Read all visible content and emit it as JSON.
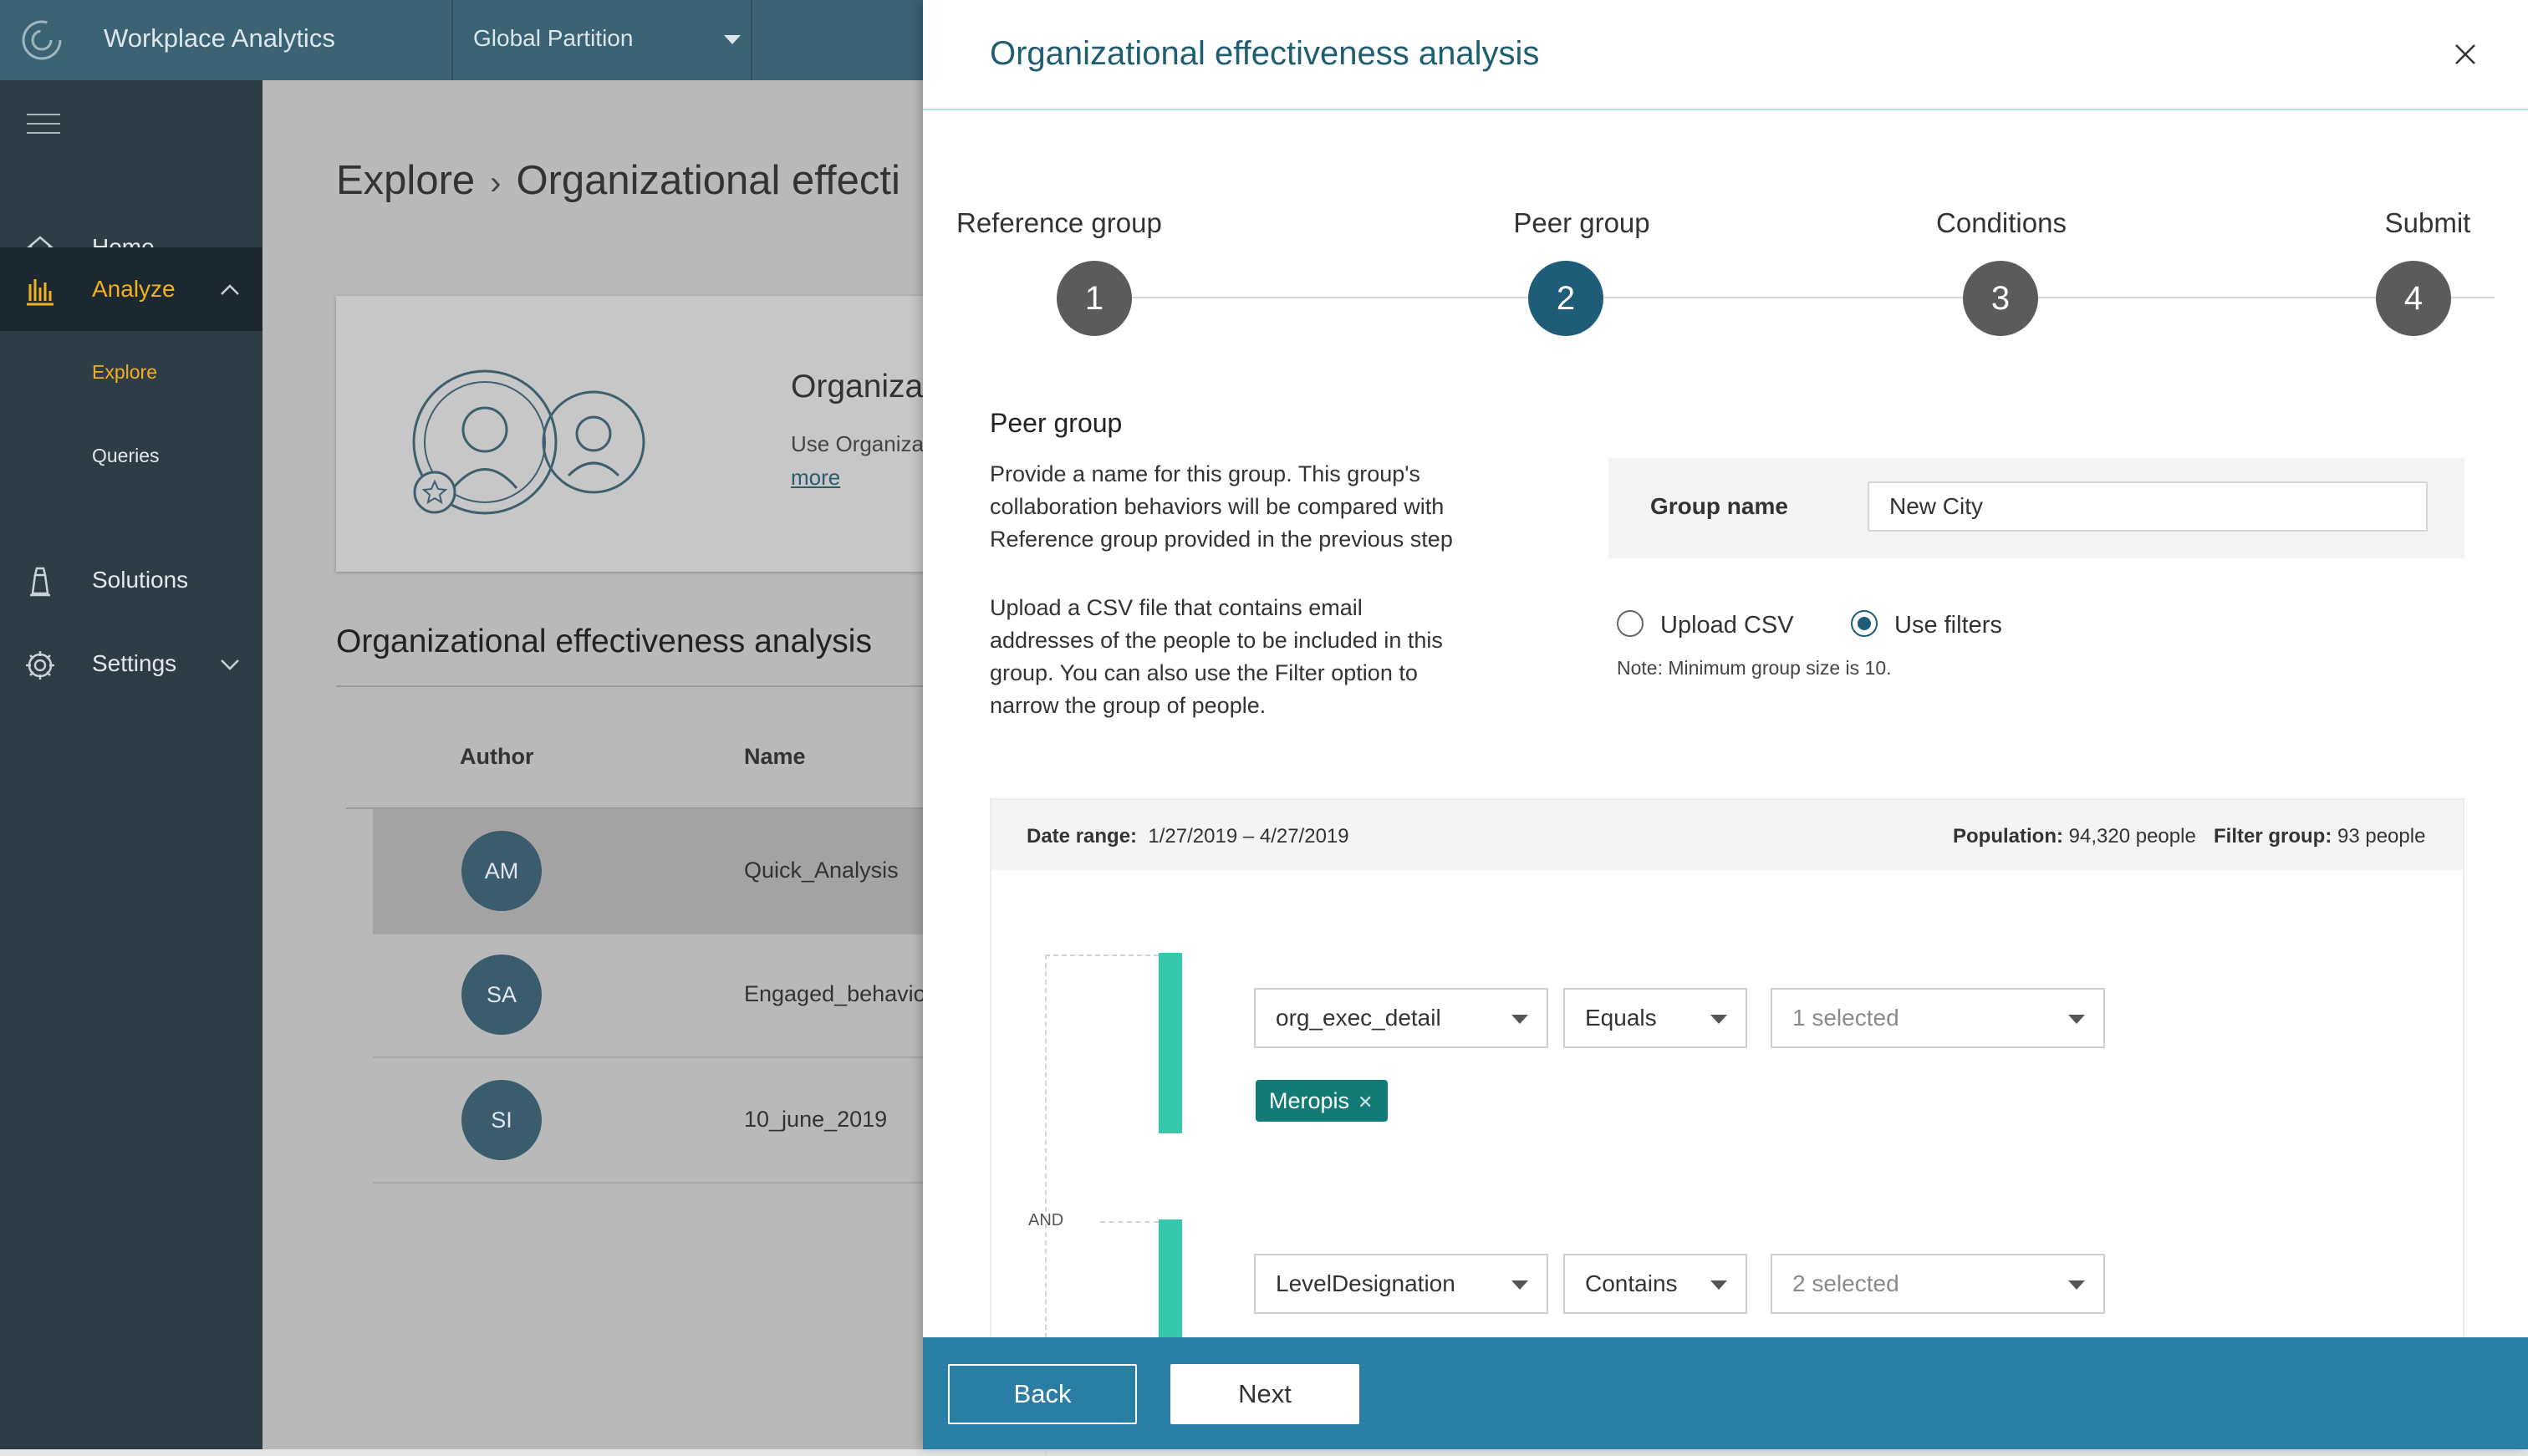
{
  "header": {
    "app_title": "Workplace Analytics",
    "partition_label": "Global Partition"
  },
  "sidebar": {
    "items": [
      {
        "label": "Home",
        "icon": "home-icon"
      },
      {
        "label": "Analyze",
        "icon": "chart-icon",
        "active": true
      },
      {
        "label": "Solutions",
        "icon": "lighthouse-icon"
      },
      {
        "label": "Settings",
        "icon": "gear-icon"
      }
    ],
    "sub_items": [
      {
        "label": "Explore",
        "active": true
      },
      {
        "label": "Queries"
      }
    ]
  },
  "background": {
    "breadcrumb": {
      "root": "Explore",
      "current": "Organizational effecti"
    },
    "card": {
      "title": "Organizationa",
      "desc": "Use Organizational e",
      "more": "more"
    },
    "section_title": "Organizational effectiveness analysis",
    "table": {
      "headers": [
        "Author",
        "Name"
      ],
      "rows": [
        {
          "initials": "AM",
          "name": "Quick_Analysis",
          "selected": true
        },
        {
          "initials": "SA",
          "name": "Engaged_behavio"
        },
        {
          "initials": "SI",
          "name": "10_june_2019"
        }
      ]
    }
  },
  "panel": {
    "title": "Organizational effectiveness analysis",
    "steps": [
      {
        "label": "Reference group",
        "number": "1"
      },
      {
        "label": "Peer group",
        "number": "2",
        "active": true
      },
      {
        "label": "Conditions",
        "number": "3"
      },
      {
        "label": "Submit",
        "number": "4"
      }
    ],
    "peer_group": {
      "heading": "Peer group",
      "desc1": "Provide a name for this group. This group's collaboration behaviors will be compared with Reference group provided in the previous step",
      "desc2": "Upload a CSV file that contains email addresses of the people to be included in this group. You can also use the Filter option to narrow the group of people."
    },
    "group_name": {
      "label": "Group name",
      "value": "New City"
    },
    "options": {
      "upload_csv": "Upload CSV",
      "use_filters": "Use filters",
      "selected": "use_filters",
      "note": "Note: Minimum group size is 10."
    },
    "filters": {
      "date_range_label": "Date range:",
      "date_range_value": "1/27/2019 – 4/27/2019",
      "population_label": "Population:",
      "population_value": "94,320 people",
      "filter_group_label": "Filter group:",
      "filter_group_value": "93 people",
      "and_label": "AND",
      "rows": [
        {
          "attribute": "org_exec_detail",
          "operator": "Equals",
          "values": "1 selected",
          "chip": "Meropis"
        },
        {
          "attribute": "LevelDesignation",
          "operator": "Contains",
          "values": "2 selected"
        }
      ]
    },
    "footer": {
      "back": "Back",
      "next": "Next"
    }
  },
  "colors": {
    "header": "#3b6374",
    "sidebar": "#2e3c45",
    "accent": "#f2b01e",
    "primary": "#1f5c78",
    "footer": "#2a7da3",
    "filter_bar": "#35c9a9",
    "chip": "#127b75"
  }
}
